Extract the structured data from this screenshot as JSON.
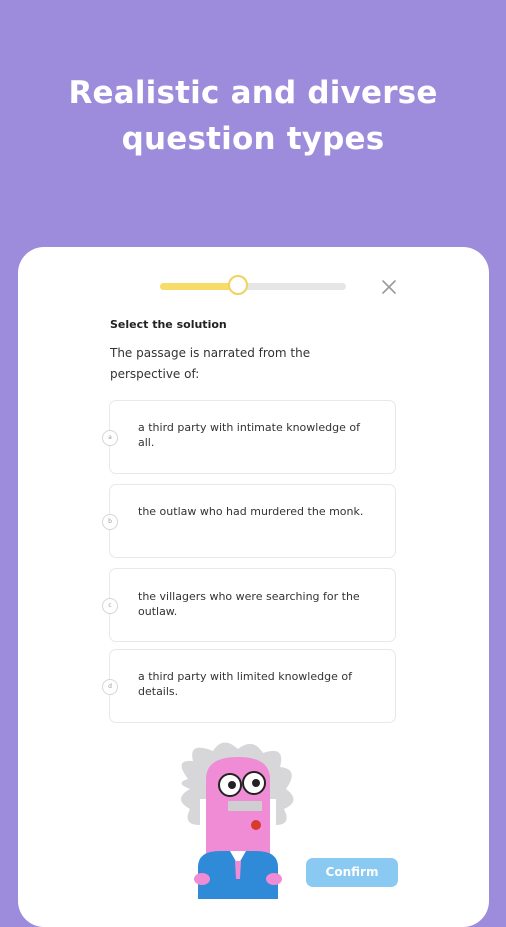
{
  "headline": {
    "line1": "Realistic and diverse",
    "line2": "question types"
  },
  "quiz": {
    "progress_fraction": 0.42,
    "instruction": "Select the solution",
    "question": "The passage is narrated from the perspective of:",
    "options": [
      {
        "letter": "a",
        "text": "a third party with intimate knowledge of all."
      },
      {
        "letter": "b",
        "text": "the outlaw who had murdered the monk."
      },
      {
        "letter": "c",
        "text": "the villagers who were searching for the outlaw."
      },
      {
        "letter": "d",
        "text": "a third party with limited knowledge of details."
      }
    ],
    "confirm_label": "Confirm",
    "close_icon": "close-icon"
  },
  "colors": {
    "background": "#9d8cdc",
    "progress_fill": "#f7dc6a",
    "confirm_button": "#89c9f2"
  }
}
